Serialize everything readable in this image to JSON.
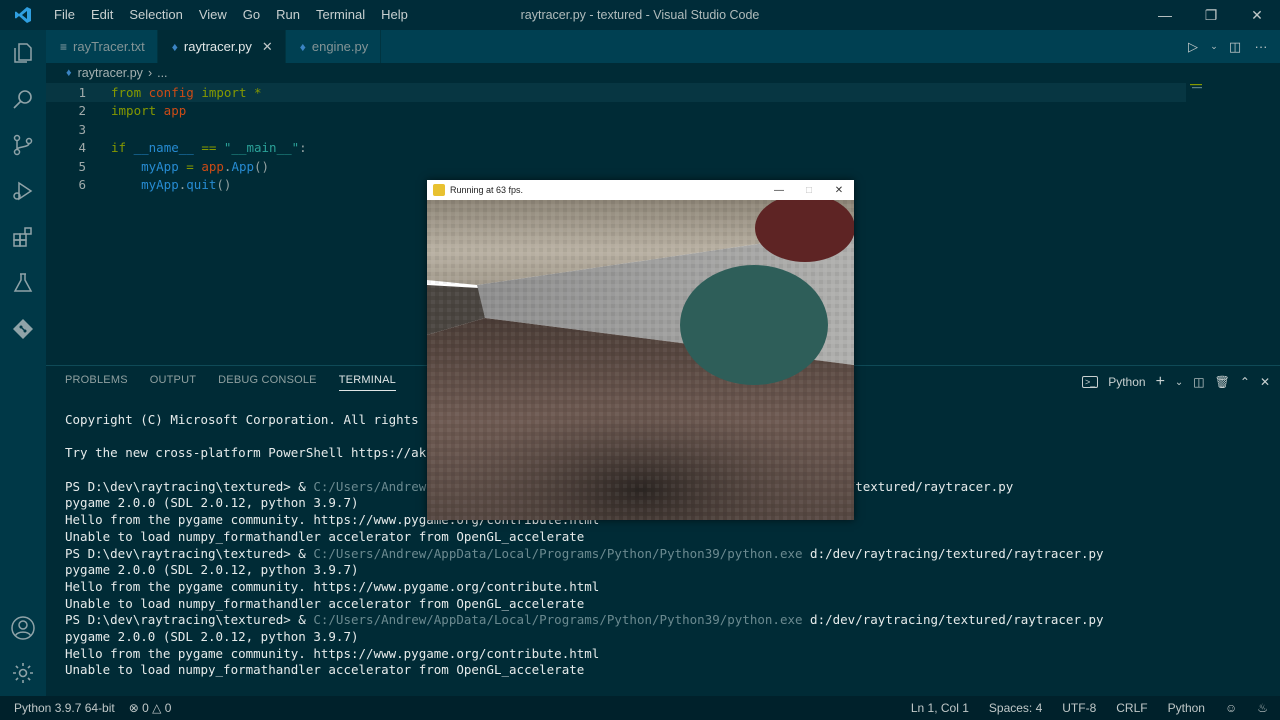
{
  "window_title": "raytracer.py - textured - Visual Studio Code",
  "menu": [
    "File",
    "Edit",
    "Selection",
    "View",
    "Go",
    "Run",
    "Terminal",
    "Help"
  ],
  "tabs": [
    {
      "label": "rayTracer.txt",
      "icon": "list-icon",
      "active": false
    },
    {
      "label": "raytracer.py",
      "icon": "python-icon",
      "active": true
    },
    {
      "label": "engine.py",
      "icon": "python-icon",
      "active": false
    }
  ],
  "breadcrumb": {
    "file": "raytracer.py",
    "more": "..."
  },
  "editor": {
    "line_numbers": [
      "1",
      "2",
      "3",
      "4",
      "5",
      "6"
    ],
    "lines": [
      {
        "t1": "from",
        "t2": " config",
        "t3": " import",
        "t4": " *"
      },
      {
        "t1": "import",
        "t2": " app"
      },
      {},
      {
        "t1": "if",
        "t2": " __name__",
        "t3": " ==",
        "t4": " \"__main__\"",
        "t5": ":"
      },
      {
        "indent": "    ",
        "t1": "myApp",
        "t2": " = ",
        "t3": "app",
        "t4": ".",
        "t5": "App",
        "t6": "()"
      },
      {
        "indent": "    ",
        "t1": "myApp",
        "t2": ".",
        "t3": "quit",
        "t4": "()"
      }
    ]
  },
  "panel": {
    "tabs": [
      "PROBLEMS",
      "OUTPUT",
      "DEBUG CONSOLE",
      "TERMINAL"
    ],
    "active_tab": "TERMINAL",
    "shell": "Python"
  },
  "terminal": {
    "line1": "Copyright (C) Microsoft Corporation. All rights re",
    "line2": "",
    "line3": "Try the new cross-platform PowerShell https://aka",
    "line4": "",
    "r1_prompt": "PS D:\\dev\\raytracing\\textured> & ",
    "r1_exe": "C:/Users/Andrew/A",
    "r1_gap": "                                            ",
    "r1_script": "raytracing/textured/raytracer.py",
    "r1_l2": "pygame 2.0.0 (SDL 2.0.12, python 3.9.7)",
    "r1_l3": "Hello from the pygame community. https://www.pygame.org/contribute.html",
    "r1_l4": "Unable to load numpy_formathandler accelerator from OpenGL_accelerate",
    "r2_prompt": "PS D:\\dev\\raytracing\\textured> & ",
    "r2_exe": "C:/Users/Andrew/AppData/Local/Programs/Python/Python39/python.exe",
    "r2_script": " d:/dev/raytracing/textured/raytracer.py",
    "r2_l2": "pygame 2.0.0 (SDL 2.0.12, python 3.9.7)",
    "r2_l3": "Hello from the pygame community. https://www.pygame.org/contribute.html",
    "r2_l4": "Unable to load numpy_formathandler accelerator from OpenGL_accelerate",
    "r3_prompt": "PS D:\\dev\\raytracing\\textured> & ",
    "r3_exe": "C:/Users/Andrew/AppData/Local/Programs/Python/Python39/python.exe",
    "r3_script": " d:/dev/raytracing/textured/raytracer.py",
    "r3_l2": "pygame 2.0.0 (SDL 2.0.12, python 3.9.7)",
    "r3_l3": "Hello from the pygame community. https://www.pygame.org/contribute.html",
    "r3_l4": "Unable to load numpy_formathandler accelerator from OpenGL_accelerate"
  },
  "status": {
    "interpreter": "Python 3.9.7 64-bit",
    "errors": "0",
    "warnings": "0",
    "position": "Ln 1, Col 1",
    "spaces": "Spaces: 4",
    "encoding": "UTF-8",
    "eol": "CRLF",
    "language": "Python"
  },
  "pygame": {
    "title": "Running at 63 fps."
  },
  "colors": {
    "editor_bg": "#002b36",
    "keyword": "#859900",
    "module": "#cb4b16",
    "string": "#2aa198",
    "function": "#268bd2",
    "sphere_teal": "#2e5e59",
    "sphere_red": "#5e2424"
  }
}
